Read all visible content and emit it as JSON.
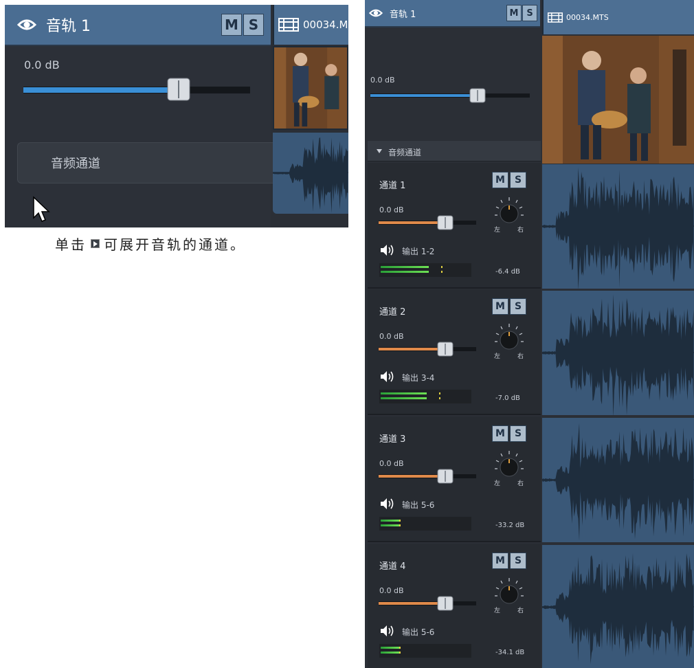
{
  "left": {
    "track_title": "音轨 1",
    "mute_label": "M",
    "solo_label": "S",
    "volume": "0.0 dB",
    "clip_name": "00034.M",
    "channels_label": "音频通道"
  },
  "caption": {
    "before": "单击",
    "after": "可展开音轨的通道。"
  },
  "right": {
    "track_title": "音轨 1",
    "mute_label": "M",
    "solo_label": "S",
    "volume": "0.0 dB",
    "clip_name": "00034.MTS",
    "channels_label": "音频通道",
    "pan_left": "左",
    "pan_right": "右",
    "channels": [
      {
        "name": "通道 1",
        "volume": "0.0 dB",
        "output": "输出 1-2",
        "level": "-6.4 dB",
        "meter_fraction": 0.52
      },
      {
        "name": "通道 2",
        "volume": "0.0 dB",
        "output": "输出 3-4",
        "level": "-7.0 dB",
        "meter_fraction": 0.5
      },
      {
        "name": "通道 3",
        "volume": "0.0 dB",
        "output": "输出 5-6",
        "level": "-33.2 dB",
        "meter_fraction": 0.2
      },
      {
        "name": "通道 4",
        "volume": "0.0 dB",
        "output": "输出 5-6",
        "level": "-34.1 dB",
        "meter_fraction": 0.2
      }
    ]
  },
  "colors": {
    "track_header": "#4a6d92",
    "panel_bg": "#2b2f36",
    "track_volume_fill": "#3a8fd6",
    "channel_volume_fill": "#e08a4a",
    "waveform_bg": "#3a5878",
    "waveform": "#1e2d3d"
  },
  "icons": [
    "eye-icon",
    "film-icon",
    "speaker-icon",
    "pan-knob-icon",
    "cursor-icon",
    "expand-triangle-icon"
  ]
}
